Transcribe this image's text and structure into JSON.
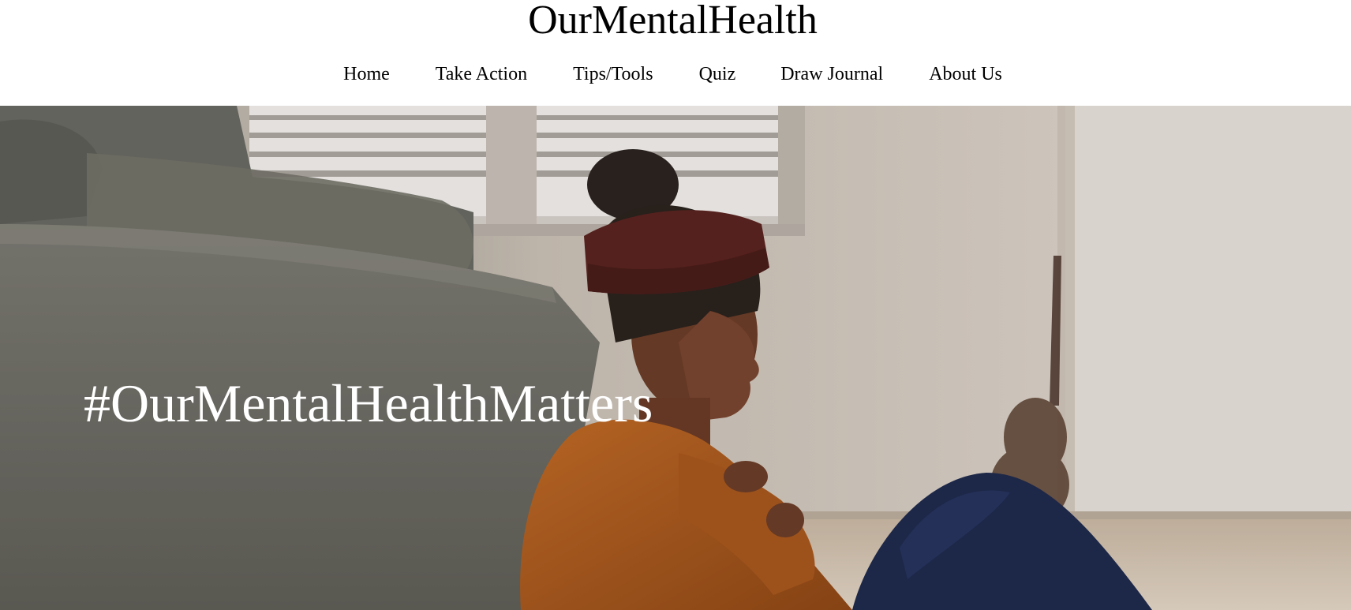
{
  "site": {
    "title": "OurMentalHealth"
  },
  "nav": {
    "items": [
      {
        "label": "Home"
      },
      {
        "label": "Take Action"
      },
      {
        "label": "Tips/Tools"
      },
      {
        "label": "Quiz"
      },
      {
        "label": "Draw Journal"
      },
      {
        "label": "About Us"
      }
    ]
  },
  "hero": {
    "tagline": "#OurMentalHealthMatters",
    "image_subject": "woman-sitting-on-floor-by-couch",
    "colors": {
      "wall": "#d6cdc2",
      "couch": "#6f6e66",
      "sweater": "#b4601f",
      "headband": "#5a2420",
      "jeans": "#1f2a4d",
      "tagline": "#ffffff"
    }
  }
}
